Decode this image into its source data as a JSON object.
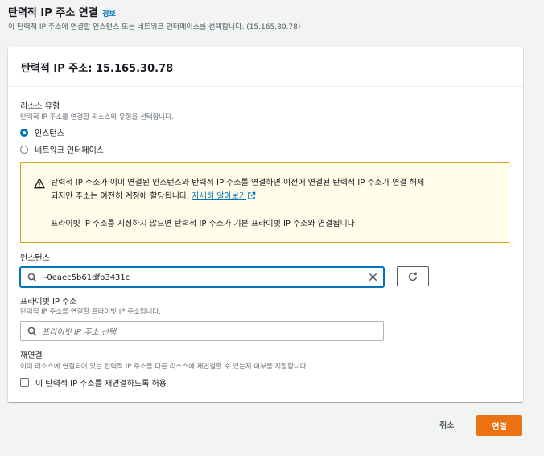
{
  "header": {
    "title": "탄력적 IP 주소 연결",
    "info_link": "정보",
    "description": "이 탄력적 IP 주소에 연결할 인스턴스 또는 네트워크 인터페이스를 선택합니다. (15.165.30.78)"
  },
  "panel": {
    "title": "탄력적 IP 주소: 15.165.30.78",
    "resource_type": {
      "label": "리소스 유형",
      "description": "탄력적 IP 주소를 연결할 리소스의 유형을 선택합니다.",
      "options": [
        {
          "label": "인스턴스",
          "selected": true
        },
        {
          "label": "네트워크 인터페이스",
          "selected": false
        }
      ]
    },
    "alert": {
      "line1": "탄력적 IP 주소가 이미 연결된 인스턴스와 탄력적 IP 주소를 연결하면 이전에 연결된 탄력적 IP 주소가 연결 해제",
      "line2": "되지만 주소는 여전히 계정에 할당됩니다. ",
      "link": "자세히 알아보기",
      "line3": "프라이빗 IP 주소를 지정하지 않으면 탄력적 IP 주소가 기본 프라이빗 IP 주소와 연결됩니다."
    },
    "instance": {
      "label": "인스턴스",
      "value": "i-0eaec5b61dfb3431c"
    },
    "private_ip": {
      "label": "프라이빗 IP 주소",
      "description": "탄력적 IP 주소를 연결할 프라이빗 IP 주소입니다.",
      "placeholder": "프라이빗 IP 주소 선택"
    },
    "reassociation": {
      "label": "재연결",
      "description": "이미 리소스에 연결되어 있는 탄력적 IP 주소를 다른 리소스에 재연결할 수 있는지 여부를 지정합니다.",
      "checkbox_label": "이 탄력적 IP 주소를 재연결하도록 허용",
      "checked": false
    }
  },
  "footer": {
    "cancel_label": "취소",
    "submit_label": "연결"
  },
  "colors": {
    "accent": "#0073bb",
    "primary_button": "#ec7211",
    "warning_border": "#d5a220",
    "warning_bg": "#fffce9"
  },
  "icons": [
    "warning-icon",
    "external-link-icon",
    "search-icon",
    "clear-icon",
    "refresh-icon"
  ]
}
